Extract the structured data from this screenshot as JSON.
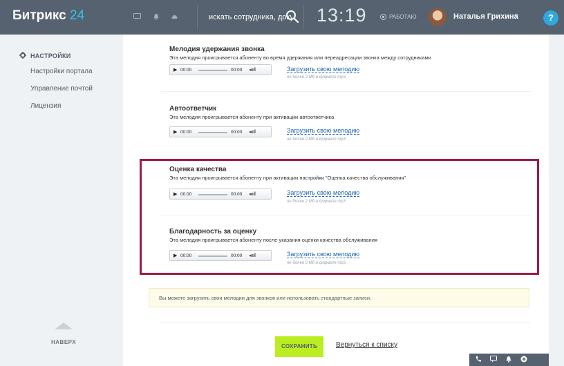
{
  "header": {
    "logo_text": "Битрикс",
    "logo_num": "24",
    "search_placeholder": "искать сотрудника, документ",
    "time": "13:19",
    "status": "РАБОТАЮ",
    "user_name": "Наталья Грихина",
    "help": "?"
  },
  "sidebar": {
    "title": "НАСТРОЙКИ",
    "items": [
      "Настройки портала",
      "Управление почтой",
      "Лицензия"
    ],
    "up_label": "НАВЕРХ"
  },
  "blocks": [
    {
      "title": "Мелодия удержания звонка",
      "desc": "Эта мелодия проигрывается абоненту во время удержания или переадресации звонка между сотрудниками"
    },
    {
      "title": "Автоответчик",
      "desc": "Эта мелодия проигрывается абоненту при активации автоответчика"
    },
    {
      "title": "Оценка качества",
      "desc": "Эта мелодия проигрывается абоненту при активации настройки \"Оценка качества обслуживания\""
    },
    {
      "title": "Благодарность за оценку",
      "desc": "Эта мелодия проигрывается абоненту после указания оценки качества обслуживания"
    }
  ],
  "player": {
    "time_start": "00:00",
    "time_end": "00:00"
  },
  "upload": {
    "link": "Загрузить свою мелодию",
    "note": "не более 2 Мб в формате mp3"
  },
  "notice": "Вы можете загрузить свои мелодии для звонков или использовать стандартные записи.",
  "actions": {
    "save": "СОХРАНИТЬ",
    "back": "Вернуться к списку"
  },
  "colors": {
    "header_bg": "#56626f",
    "accent_blue": "#2fc6f6",
    "save_green": "#bbed21",
    "highlight_border": "#9b1a4a",
    "link_blue": "#2067b0"
  }
}
